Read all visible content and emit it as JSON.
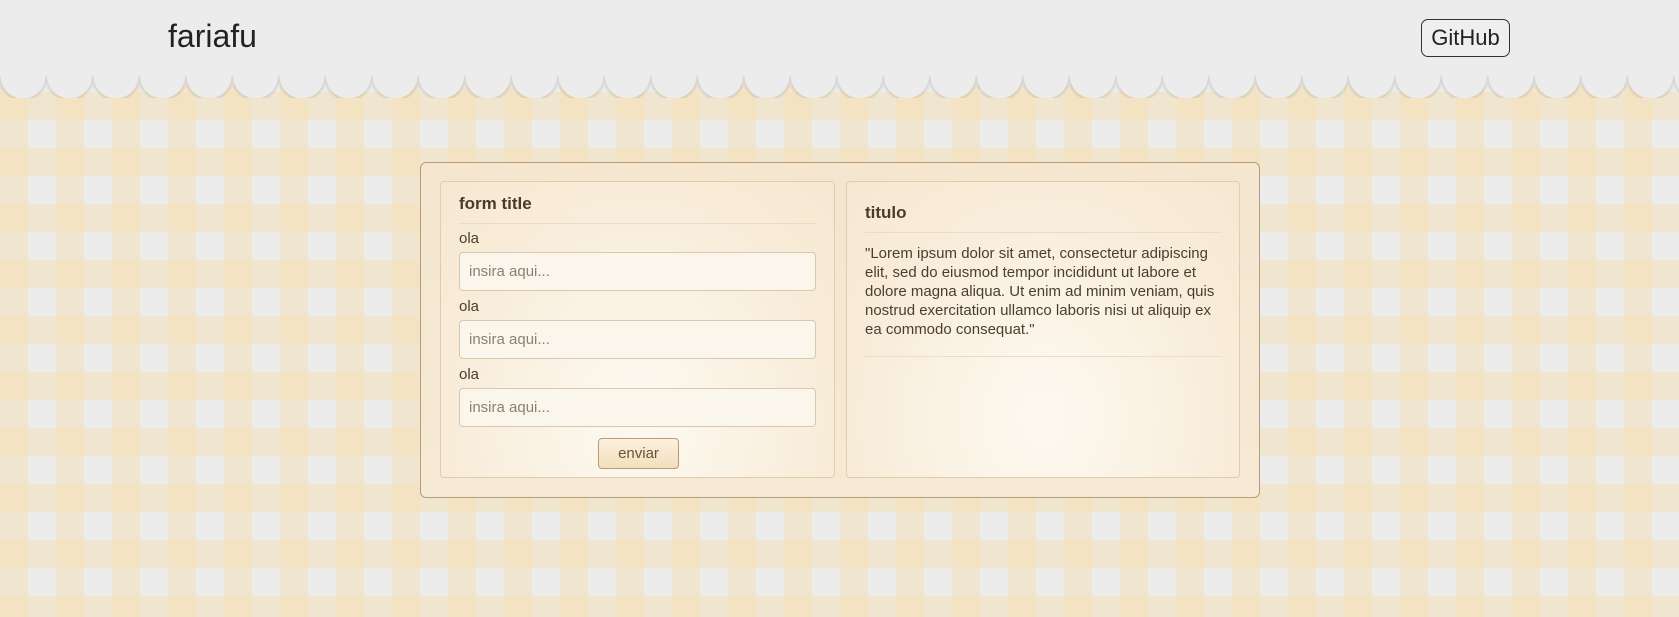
{
  "header": {
    "brand": "fariafu",
    "github_label": "GitHub"
  },
  "form_card": {
    "title": "form title",
    "fields": [
      {
        "label": "ola",
        "placeholder": "insira aqui..."
      },
      {
        "label": "ola",
        "placeholder": "insira aqui..."
      },
      {
        "label": "ola",
        "placeholder": "insira aqui..."
      }
    ],
    "submit_label": "enviar"
  },
  "text_card": {
    "title": "titulo",
    "body": "\"Lorem ipsum dolor sit amet, consectetur adipiscing elit, sed do eiusmod tempor incididunt ut labore et dolore magna aliqua. Ut enim ad minim veniam, quis nostrud exercitation ullamco laboris nisi ut aliquip ex ea commodo consequat.\""
  },
  "colors": {
    "header_bg": "#ececec",
    "panel_border": "#b79c77",
    "checker_tan": "#f5e1b9",
    "checker_gray": "#ececec"
  }
}
